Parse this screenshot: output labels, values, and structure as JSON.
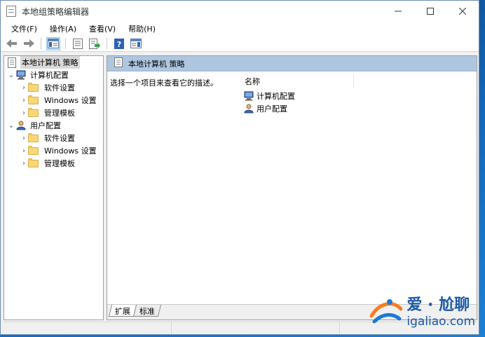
{
  "window": {
    "title": "本地组策略编辑器"
  },
  "menu": {
    "items": [
      "文件(F)",
      "操作(A)",
      "查看(V)",
      "帮助(H)"
    ]
  },
  "toolbar": {
    "buttons": [
      "back-icon",
      "forward-icon",
      "show-hide-tree-icon",
      "properties-icon",
      "export-list-icon",
      "help-icon",
      "show-hide-action-pane-icon"
    ]
  },
  "tree": {
    "root": "本地计算机 策略",
    "computer_config": "计算机配置",
    "user_config": "用户配置",
    "computer_children": [
      "软件设置",
      "Windows 设置",
      "管理模板"
    ],
    "user_children": [
      "软件设置",
      "Windows 设置",
      "管理模板"
    ]
  },
  "detail": {
    "header": "本地计算机 策略",
    "description": "选择一个项目来查看它的描述。",
    "column_name": "名称",
    "items": [
      "计算机配置",
      "用户配置"
    ]
  },
  "tabs": [
    "扩展",
    "标准"
  ],
  "watermark": {
    "line1": "爱 · 尬聊",
    "line2": "igaliao.com"
  },
  "colors": {
    "header_band": "#aec6e0",
    "selected_toolbar": "#cce4f7",
    "folder": "#f8d775"
  }
}
